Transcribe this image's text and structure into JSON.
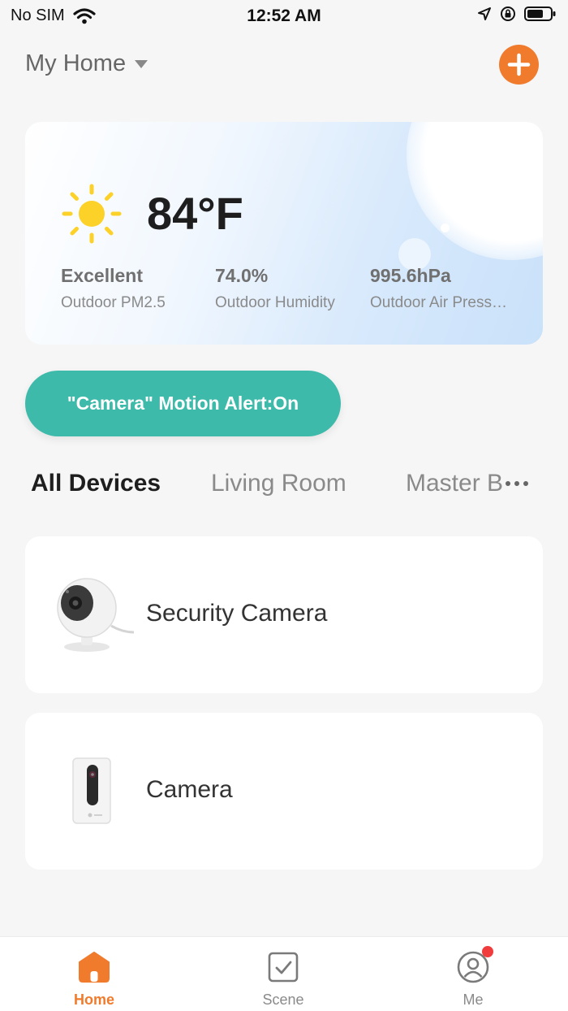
{
  "status_bar": {
    "carrier": "No SIM",
    "time": "12:52 AM"
  },
  "header": {
    "home_name": "My Home"
  },
  "weather": {
    "temperature": "84°F",
    "icon": "sun-icon",
    "metrics": [
      {
        "value": "Excellent",
        "label": "Outdoor PM2.5"
      },
      {
        "value": "74.0%",
        "label": "Outdoor Humidity"
      },
      {
        "value": "995.6hPa",
        "label": "Outdoor Air Pressure"
      }
    ]
  },
  "motion_alert": {
    "label": "\"Camera\" Motion Alert:On"
  },
  "rooms": {
    "tabs": [
      "All Devices",
      "Living Room",
      "Master Bedroom"
    ]
  },
  "devices": [
    {
      "name": "Security Camera",
      "icon": "security-camera-image"
    },
    {
      "name": "Camera",
      "icon": "indoor-camera-image"
    }
  ],
  "tab_bar": {
    "items": [
      {
        "label": "Home",
        "icon": "home-icon",
        "active": true
      },
      {
        "label": "Scene",
        "icon": "scene-checkbox-icon",
        "active": false
      },
      {
        "label": "Me",
        "icon": "profile-icon",
        "active": false
      }
    ]
  },
  "colors": {
    "accent": "#f07b2d",
    "alert_teal": "#3dbaaa",
    "badge_red": "#f03c3c"
  }
}
